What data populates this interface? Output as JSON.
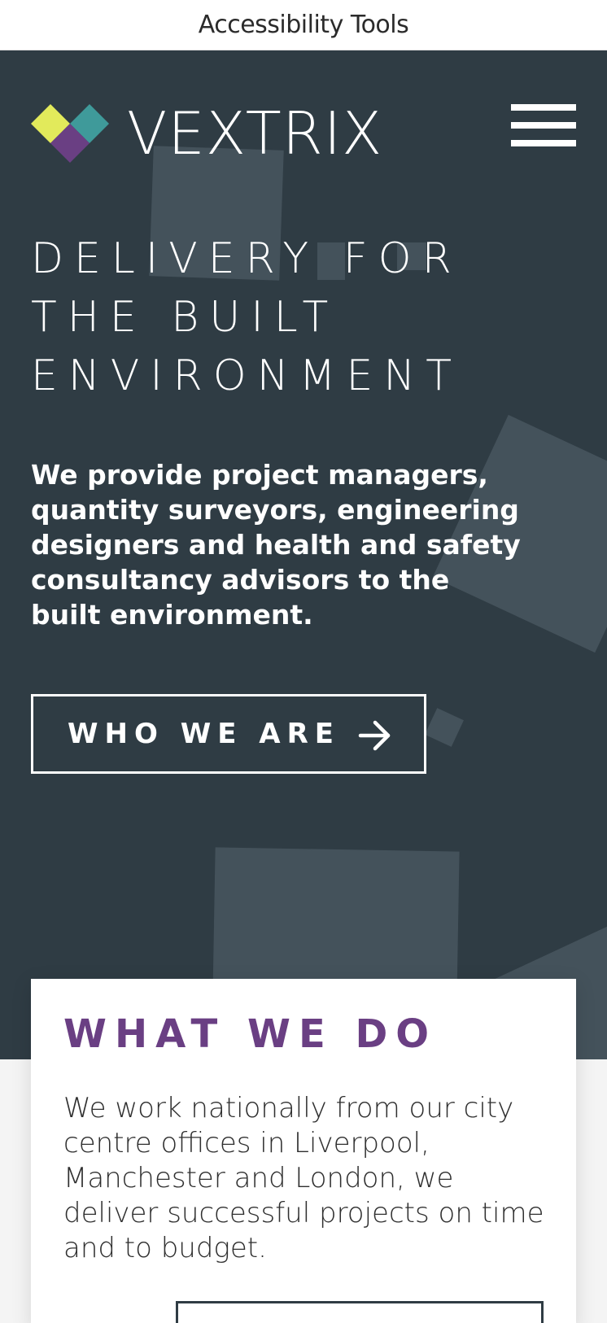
{
  "accessibility_bar": {
    "label": "Accessibility Tools"
  },
  "header": {
    "brand": "VEXTRIX",
    "logo_colors": {
      "top_left": "#e2ea5b",
      "top_right": "#3f9a9a",
      "bottom": "#6a3f83"
    },
    "menu_icon": "hamburger-menu-icon"
  },
  "hero": {
    "title_lines": [
      "DELIVERY FOR",
      "THE BUILT",
      "ENVIRONMENT"
    ],
    "subtitle": "We provide project managers, quantity surveyors, engineering designers and health and safety consultancy advisors to the built environment.",
    "cta_label": "WHO WE ARE",
    "cta_icon": "arrow-right-icon",
    "background_color": "#2f3c44"
  },
  "what_we_do": {
    "title": "WHAT WE DO",
    "text": "We work nationally from our city centre offices in Liverpool, Manchester and London, we deliver successful projects on time and to budget.",
    "accent_color": "#6a3f83"
  }
}
